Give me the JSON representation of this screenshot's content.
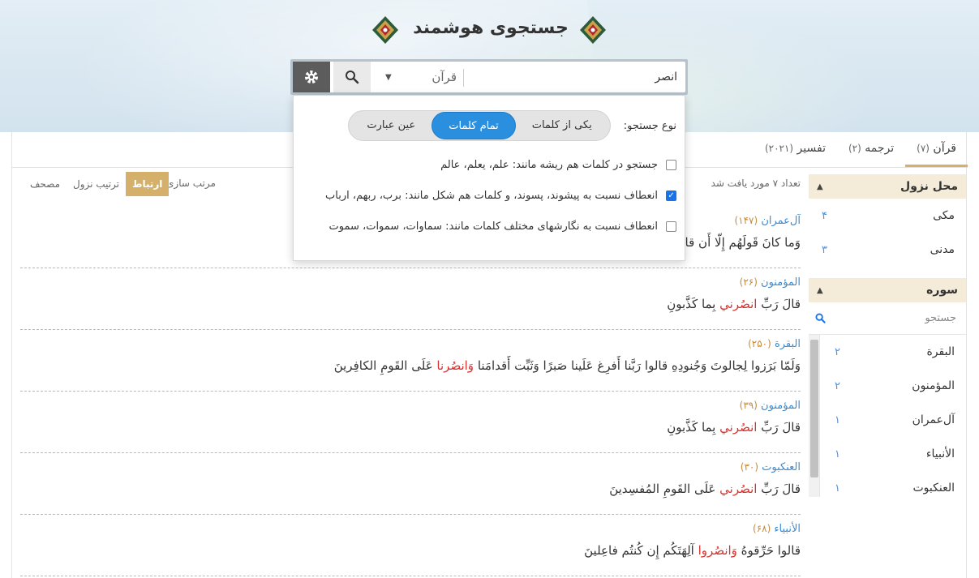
{
  "header": {
    "title": "جستجوی هوشمند"
  },
  "search": {
    "value": "انصر",
    "scope": "قرآن",
    "gear_icon": "gear-icon",
    "search_icon": "search-icon"
  },
  "settings": {
    "type_label": "نوع جستجو:",
    "options": [
      "یکی از کلمات",
      "تمام کلمات",
      "عین عبارت"
    ],
    "active_option": "تمام کلمات",
    "checks": [
      {
        "label": "جستجو در کلمات هم ریشه مانند: علم، یعلم، عالم",
        "checked": false
      },
      {
        "label": "انعطاف نسبت به پیشوند، پسوند، و کلمات هم شکل مانند: برب، ربهم، ارباب",
        "checked": true
      },
      {
        "label": "انعطاف نسبت به نگارشهای مختلف کلمات مانند: سماوات، سموات، سموت",
        "checked": false
      }
    ]
  },
  "tabs": [
    {
      "label": "قرآن",
      "count": "(۷)"
    },
    {
      "label": "ترجمه",
      "count": "(۲)"
    },
    {
      "label": "تفسیر",
      "count": "(۲۰۲۱)"
    }
  ],
  "sidebar": {
    "revelation_title": "محل نزول",
    "revelation_items": [
      {
        "label": "مکی",
        "count": "۴"
      },
      {
        "label": "مدنی",
        "count": "۳"
      }
    ],
    "sura_title": "سوره",
    "sura_search_placeholder": "جستجو",
    "sura_items": [
      {
        "label": "البقرة",
        "count": "۲"
      },
      {
        "label": "المؤمنون",
        "count": "۲"
      },
      {
        "label": "آل‌عمران",
        "count": "۱"
      },
      {
        "label": "الأنبياء",
        "count": "۱"
      },
      {
        "label": "العنكبوت",
        "count": "۱"
      }
    ]
  },
  "sortbar": {
    "count_text": "تعداد ۷ مورد یافت شد",
    "sort_label": "مرتب سازی:",
    "options": [
      "ارتباط",
      "ترتیب نزول",
      "مصحف"
    ],
    "active": "ارتباط"
  },
  "results": [
    {
      "sura": "آل‌عمران",
      "num": "(۱۴۷)",
      "pre": "وَما كانَ قَولَهُم إِلّا أَن قالوا",
      "hl": "",
      "post": ""
    },
    {
      "sura": "المؤمنون",
      "num": "(۲۶)",
      "pre": "قالَ رَبِّ ",
      "hl": "انصُرني",
      "post": " بِما كَذَّبونِ"
    },
    {
      "sura": "البقرة",
      "num": "(۲۵۰)",
      "pre": "وَلَمّا بَرَزوا لِجالوتَ وَجُنودِهِ قالوا رَبَّنا أَفرِغ عَلَينا صَبرًا وَثَبِّت أَقدامَنا ",
      "hl": "وَانصُرنا",
      "post": " عَلَى القَومِ الكافِرينَ"
    },
    {
      "sura": "المؤمنون",
      "num": "(۳۹)",
      "pre": "قالَ رَبِّ ",
      "hl": "انصُرني",
      "post": " بِما كَذَّبونِ"
    },
    {
      "sura": "العنكبوت",
      "num": "(۳۰)",
      "pre": "قالَ رَبِّ ",
      "hl": "انصُرني",
      "post": " عَلَى القَومِ المُفسِدينَ"
    },
    {
      "sura": "الأنبياء",
      "num": "(۶۸)",
      "pre": "قالوا حَرِّقوهُ ",
      "hl": "وَانصُروا",
      "post": " آلِهَتَكُم إِن كُنتُم فاعِلينَ"
    }
  ]
}
